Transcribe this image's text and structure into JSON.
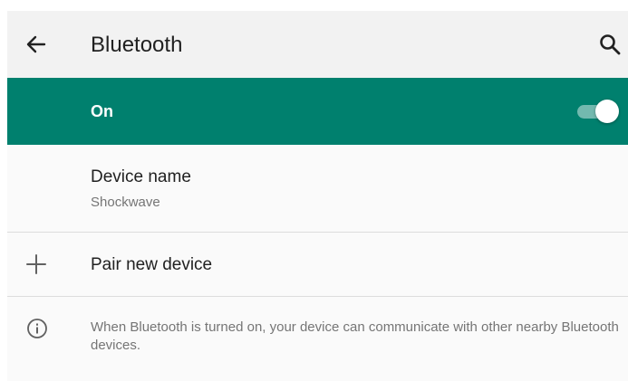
{
  "appbar": {
    "title": "Bluetooth",
    "back_icon": "arrow-left-icon",
    "search_icon": "search-icon"
  },
  "master_switch": {
    "label": "On",
    "state": "on",
    "bar_color": "#00806e"
  },
  "device_name": {
    "title": "Device name",
    "value": "Shockwave"
  },
  "pair_new": {
    "icon": "plus-icon",
    "label": "Pair new device"
  },
  "info": {
    "icon": "info-icon",
    "text": "When Bluetooth is turned on, your device can communicate with other nearby Bluetooth devices."
  }
}
